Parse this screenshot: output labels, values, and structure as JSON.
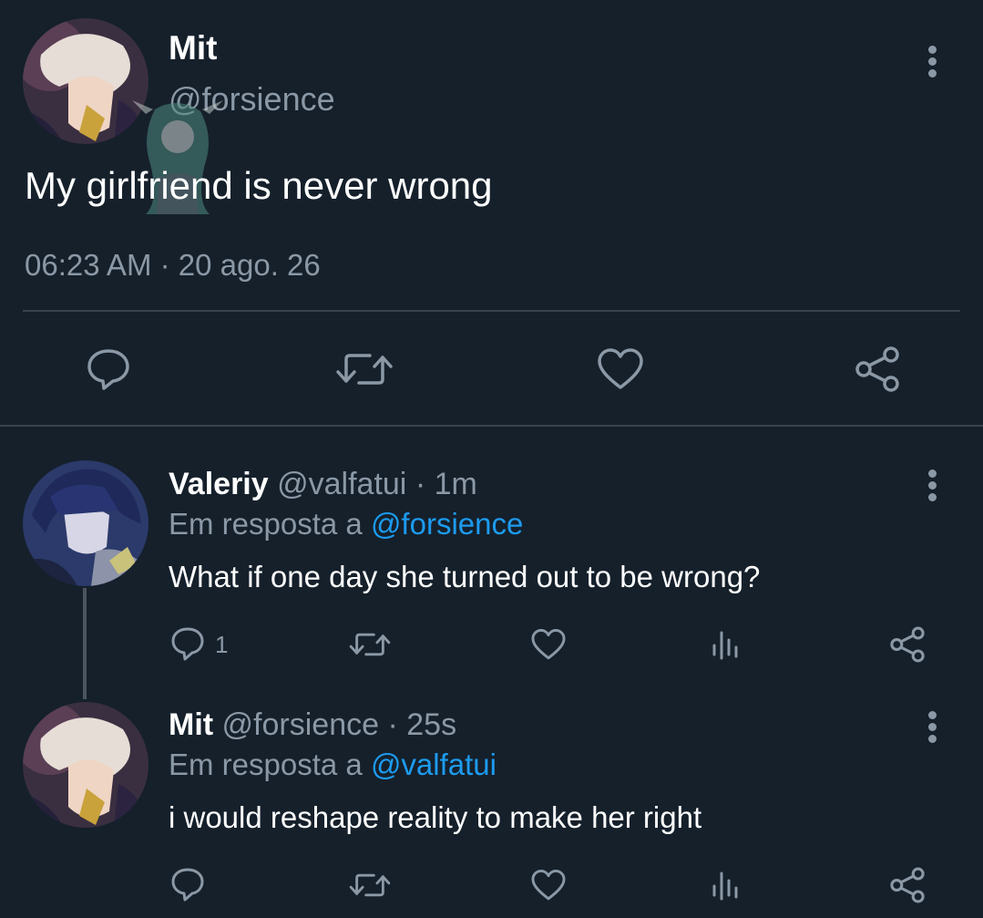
{
  "main_tweet": {
    "author_name": "Mit",
    "author_handle": "@forsience",
    "text": "My girlfriend is never wrong",
    "timestamp": "06:23 AM · 20 ago. 26",
    "actions": [
      "reply-icon",
      "retweet-icon",
      "like-icon",
      "share-icon"
    ]
  },
  "replies": [
    {
      "author_name": "Valeriy",
      "author_handle": "@valfatui",
      "time_ago": "· 1m",
      "reply_prefix": "Em resposta a",
      "reply_to": "@forsience",
      "text": "What if one day she turned out to be wrong?",
      "reply_count": "1"
    },
    {
      "author_name": "Mit",
      "author_handle": "@forsience",
      "time_ago": "· 25s",
      "reply_prefix": "Em resposta a",
      "reply_to": "@valfatui",
      "text": "i would reshape reality to make her right",
      "reply_count": ""
    }
  ],
  "colors": {
    "background": "#15202b",
    "muted": "#8b98a5",
    "link": "#1d9bf0",
    "divider": "#38444d"
  }
}
